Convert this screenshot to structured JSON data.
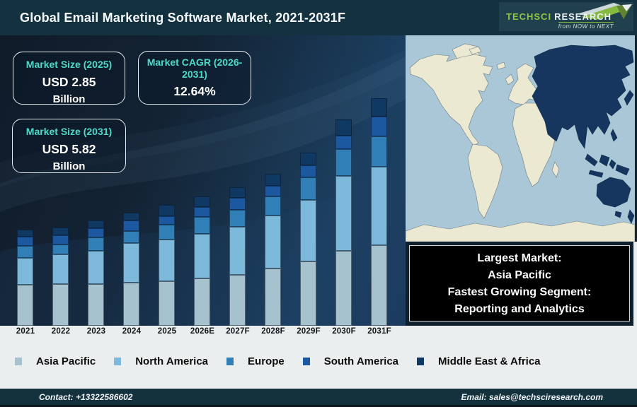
{
  "header": {
    "title": "Global Email Marketing Software Market, 2021-2031F",
    "logo": {
      "brand_primary": "TECHSCI",
      "brand_secondary": "RESEARCH",
      "tagline": "from NOW to NEXT"
    }
  },
  "callouts": {
    "size_2025": {
      "label": "Market Size (2025)",
      "value": "USD 2.85",
      "unit": "Billion"
    },
    "cagr": {
      "label": "Market CAGR (2026-2031)",
      "value": "12.64%"
    },
    "size_2031": {
      "label": "Market Size (2031)",
      "value": "USD 5.82",
      "unit": "Billion"
    }
  },
  "info_box": {
    "lines": [
      "Largest Market:",
      "Asia Pacific",
      "Fastest Growing Segment:",
      "Reporting and Analytics"
    ]
  },
  "map": {
    "highlighted_region": "Asia Pacific",
    "ocean_color": "#a9c7d6",
    "land_color": "#ece9d2",
    "highlight_color": "#16365f"
  },
  "footer": {
    "contact": "Contact: +13322586602",
    "email": "Email: sales@techsciresearch.com"
  },
  "colors": {
    "accent_teal": "#4ed9c8",
    "brand_green": "#8dc63f",
    "header_bg": "#143140",
    "footer_bg": "#14313e",
    "info_box_bg": "#000000"
  },
  "chart_data": {
    "type": "bar",
    "stacked": true,
    "title": "Global Email Marketing Software Market, 2021-2031F",
    "unit": "USD Billion",
    "legend_position": "bottom",
    "categories": [
      "2021",
      "2022",
      "2023",
      "2024",
      "2025",
      "2026E",
      "2027F",
      "2028F",
      "2029F",
      "2030F",
      "2031F"
    ],
    "series": [
      {
        "name": "Asia Pacific",
        "color": "#a7c2cf",
        "values": [
          0.94,
          0.96,
          0.96,
          0.99,
          1.03,
          1.09,
          1.17,
          1.32,
          1.48,
          1.73,
          1.86
        ]
      },
      {
        "name": "North America",
        "color": "#7db9da",
        "values": [
          0.62,
          0.68,
          0.77,
          0.91,
          0.96,
          1.03,
          1.11,
          1.22,
          1.42,
          1.73,
          1.81
        ]
      },
      {
        "name": "Europe",
        "color": "#317fb7",
        "values": [
          0.28,
          0.24,
          0.31,
          0.29,
          0.34,
          0.39,
          0.39,
          0.44,
          0.52,
          0.62,
          0.7
        ]
      },
      {
        "name": "South America",
        "color": "#1c58a0",
        "values": [
          0.21,
          0.2,
          0.21,
          0.23,
          0.2,
          0.23,
          0.28,
          0.24,
          0.28,
          0.31,
          0.46
        ]
      },
      {
        "name": "Middle East & Africa",
        "color": "#0f3862",
        "values": [
          0.16,
          0.18,
          0.18,
          0.18,
          0.26,
          0.24,
          0.24,
          0.28,
          0.29,
          0.36,
          0.42
        ]
      }
    ],
    "totals_estimated": [
      2.21,
      2.26,
      2.43,
      2.6,
      2.79,
      2.98,
      3.19,
      3.5,
      3.99,
      4.75,
      5.25
    ]
  }
}
